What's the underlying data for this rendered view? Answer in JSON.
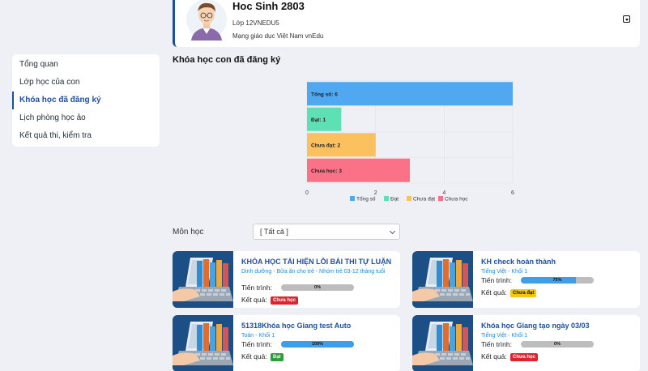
{
  "profile": {
    "name": "Hoc Sinh 2803",
    "class_code": "Lớp 12VNEDU5",
    "network": "Mạng giáo dục Việt Nam vnEdu"
  },
  "sidebar": {
    "items": [
      {
        "label": "Tổng quan",
        "active": false
      },
      {
        "label": "Lớp học của con",
        "active": false
      },
      {
        "label": "Khóa học đã đăng ký",
        "active": true
      },
      {
        "label": "Lịch phòng học ảo",
        "active": false
      },
      {
        "label": "Kết quả thi, kiểm tra",
        "active": false
      }
    ]
  },
  "section": {
    "title": "Khóa học con đã đăng ký"
  },
  "chart_data": {
    "type": "bar",
    "orientation": "horizontal",
    "categories": [
      "Tổng số",
      "Đạt",
      "Chưa đạt",
      "Chưa học"
    ],
    "bar_labels": [
      "Tổng số: 6",
      "Đạt: 1",
      "Chưa đạt: 2",
      "Chưa học: 3"
    ],
    "values": [
      6,
      1,
      2,
      3
    ],
    "colors": [
      "#4fa8f0",
      "#5ee0b4",
      "#fbc15e",
      "#fb7187"
    ],
    "xlim": [
      0,
      6
    ],
    "xticks": [
      "0",
      "2",
      "4",
      "6"
    ],
    "legend": [
      "Tổng số",
      "Đạt",
      "Chưa đạt",
      "Chưa học"
    ],
    "legend_position": "bottom"
  },
  "filter": {
    "label": "Môn học",
    "selected": "[ Tất cả ]"
  },
  "courses": [
    {
      "title": "KHÓA HỌC TÁI HIỆN LỖI BÀI THI TỰ LUẬN",
      "subtitle": "Dinh dưỡng - Bữa ăn cho trẻ - Nhóm trẻ 03-12 tháng tuổi",
      "progress_label": "Tiến trình:",
      "progress": 0,
      "progress_text": "0%",
      "result_label": "Kết quả:",
      "result": "Chưa học",
      "result_color": "#d9262c",
      "result_text_color": "#ffffff"
    },
    {
      "title": "KH check hoàn thành",
      "subtitle": "Tiếng Việt - Khối 1",
      "progress_label": "Tiến trình:",
      "progress": 75,
      "progress_text": "75%",
      "result_label": "Kết quả:",
      "result": "Chưa đạt",
      "result_color": "#f5c518",
      "result_text_color": "#111111"
    },
    {
      "title": "51318Khóa học Giang test Auto",
      "subtitle": "Toán - Khối 1",
      "progress_label": "Tiến trình:",
      "progress": 100,
      "progress_text": "100%",
      "result_label": "Kết quả:",
      "result": "Đạt",
      "result_color": "#2e9a3a",
      "result_text_color": "#ffffff"
    },
    {
      "title": "Khóa học Giang tạo ngày 03/03",
      "subtitle": "Tiếng Việt - Khối 1",
      "progress_label": "Tiến trình:",
      "progress": 0,
      "progress_text": "0%",
      "result_label": "Kết quả:",
      "result": "Chưa học",
      "result_color": "#d9262c",
      "result_text_color": "#ffffff"
    }
  ]
}
